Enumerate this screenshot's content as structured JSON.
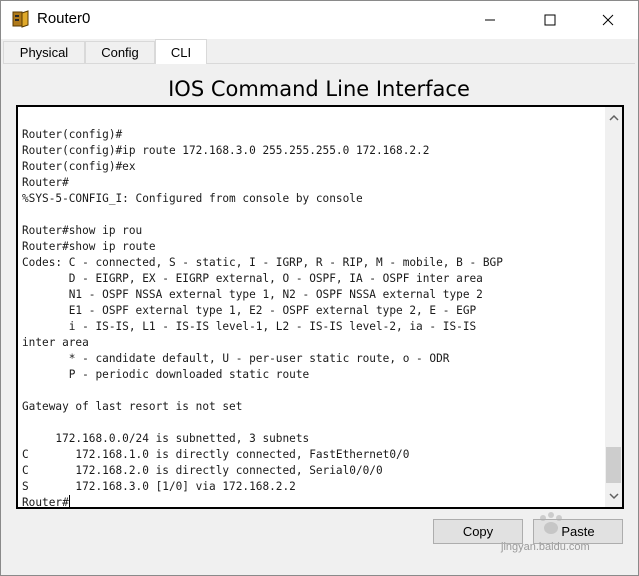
{
  "window": {
    "title": "Router0",
    "icon": "router-app-icon"
  },
  "tabs": [
    {
      "label": "Physical",
      "selected": false
    },
    {
      "label": "Config",
      "selected": false
    },
    {
      "label": "CLI",
      "selected": true
    }
  ],
  "cli": {
    "heading": "IOS Command Line Interface",
    "output_lines": [
      "Router(config)#",
      "Router(config)#ip route 172.168.3.0 255.255.255.0 172.168.2.2",
      "Router(config)#ex",
      "Router#",
      "%SYS-5-CONFIG_I: Configured from console by console",
      "",
      "Router#show ip rou",
      "Router#show ip route",
      "Codes: C - connected, S - static, I - IGRP, R - RIP, M - mobile, B - BGP",
      "       D - EIGRP, EX - EIGRP external, O - OSPF, IA - OSPF inter area",
      "       N1 - OSPF NSSA external type 1, N2 - OSPF NSSA external type 2",
      "       E1 - OSPF external type 1, E2 - OSPF external type 2, E - EGP",
      "       i - IS-IS, L1 - IS-IS level-1, L2 - IS-IS level-2, ia - IS-IS",
      "inter area",
      "       * - candidate default, U - per-user static route, o - ODR",
      "       P - periodic downloaded static route",
      "",
      "Gateway of last resort is not set",
      "",
      "     172.168.0.0/24 is subnetted, 3 subnets",
      "C       172.168.1.0 is directly connected, FastEthernet0/0",
      "C       172.168.2.0 is directly connected, Serial0/0/0",
      "S       172.168.3.0 [1/0] via 172.168.2.2"
    ],
    "prompt": "Router#",
    "copy_label": "Copy",
    "paste_label": "Paste"
  },
  "watermark": {
    "brand": "Baidu 经验",
    "url": "jingyan.baidu.com"
  }
}
